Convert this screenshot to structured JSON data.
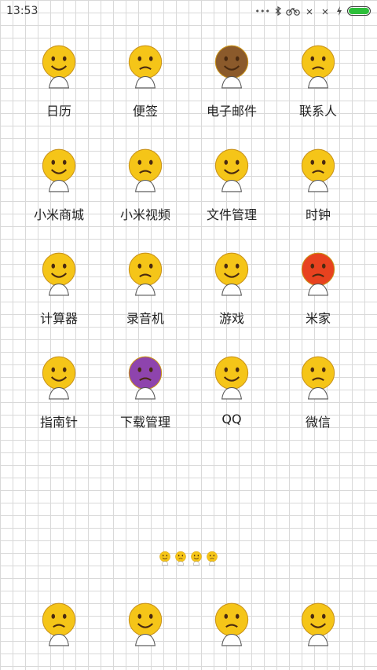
{
  "status_bar": {
    "time": "13:53",
    "battery_level": 1.0,
    "icons": [
      "dots-icon",
      "bluetooth-icon",
      "bicycle-icon",
      "signal-x-icon",
      "wifi-x-icon",
      "charging-icon",
      "battery-icon"
    ]
  },
  "apps": [
    {
      "label": "日历",
      "icon": "smiley-hugging-gray-box-icon",
      "color": "#f5c518"
    },
    {
      "label": "便签",
      "icon": "smiley-with-drum-icon",
      "color": "#f5c518"
    },
    {
      "label": "电子邮件",
      "icon": "monkey-face-icon",
      "color": "#8b5a2b"
    },
    {
      "label": "联系人",
      "icon": "two-smileys-kissing-icon",
      "color": "#f5c518"
    },
    {
      "label": "小米商城",
      "icon": "dizzy-face-on-stand-icon",
      "color": "#f5c518"
    },
    {
      "label": "小米视频",
      "icon": "angry-face-with-scarf-icon",
      "color": "#f5c518"
    },
    {
      "label": "文件管理",
      "icon": "surprised-face-red-shirt-icon",
      "color": "#f5c518"
    },
    {
      "label": "时钟",
      "icon": "sleeping-face-praying-icon",
      "color": "#f5c518"
    },
    {
      "label": "计算器",
      "icon": "faces-with-gold-bars-icon",
      "color": "#f5c518"
    },
    {
      "label": "录音机",
      "icon": "face-with-green-cap-icon",
      "color": "#f5c518"
    },
    {
      "label": "游戏",
      "icon": "tongue-face-with-controller-icon",
      "color": "#f5c518"
    },
    {
      "label": "米家",
      "icon": "red-angry-face-waving-icon",
      "color": "#e8421f"
    },
    {
      "label": "指南针",
      "icon": "flushed-face-sitting-icon",
      "color": "#f5c518"
    },
    {
      "label": "下载管理",
      "icon": "purple-devil-face-icon",
      "color": "#8e44ad"
    },
    {
      "label": "QQ",
      "icon": "face-lifting-green-disc-icon",
      "color": "#f5c518"
    },
    {
      "label": "微信",
      "icon": "laughing-face-flying-icon",
      "color": "#f5c518"
    }
  ],
  "page_indicator": {
    "icons": [
      "dizzy-face-icon",
      "crying-laughing-face-icon",
      "dizzy-face-icon",
      "dizzy-face-icon"
    ]
  },
  "dock": [
    {
      "icon": "grinning-face-waving-icon",
      "color": "#f5c518"
    },
    {
      "icon": "dizzy-face-sitting-icon",
      "color": "#f5c518"
    },
    {
      "icon": "angel-faces-lying-icon",
      "color": "#f5c518"
    },
    {
      "icon": "heart-eyes-face-sitting-icon",
      "color": "#f5c518"
    }
  ]
}
